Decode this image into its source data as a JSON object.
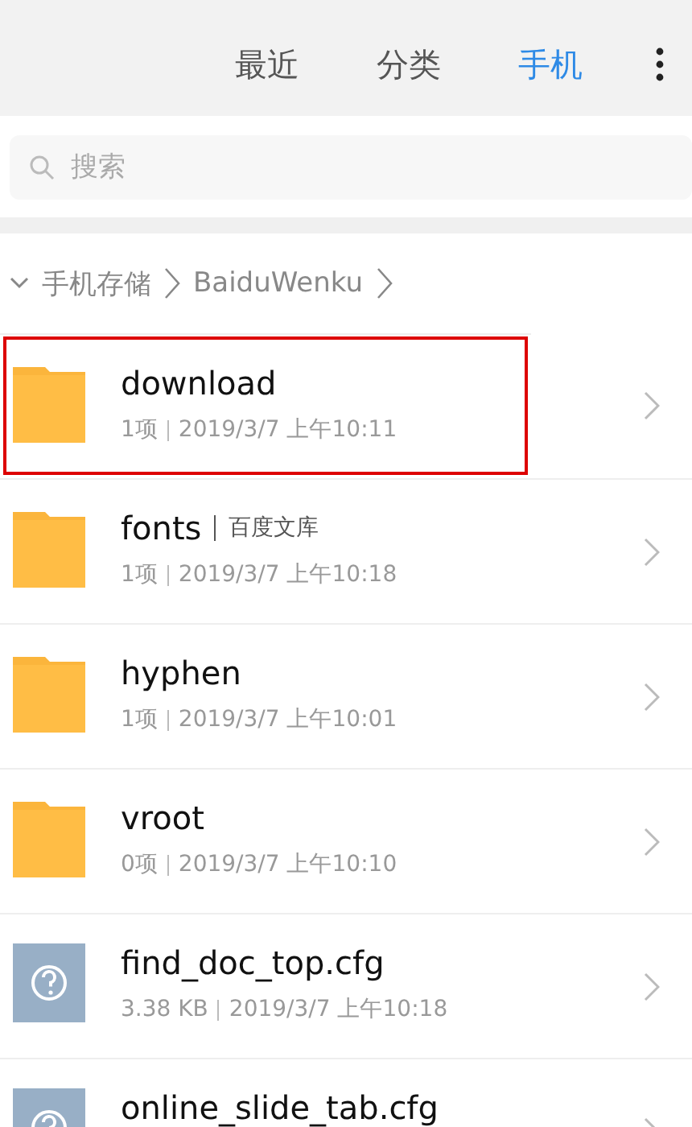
{
  "tabs": [
    {
      "label": "最近",
      "selected": false
    },
    {
      "label": "分类",
      "selected": false
    },
    {
      "label": "手机",
      "selected": true
    }
  ],
  "search": {
    "placeholder": "搜索"
  },
  "breadcrumb": [
    "手机存储",
    "BaiduWenku"
  ],
  "items": [
    {
      "kind": "folder",
      "name": "download",
      "size": "1项",
      "date": "2019/3/7 上午10:11",
      "highlighted": true
    },
    {
      "kind": "folder",
      "name": "fonts",
      "tag": "百度文库",
      "size": "1项",
      "date": "2019/3/7 上午10:18",
      "highlighted": false
    },
    {
      "kind": "folder",
      "name": "hyphen",
      "size": "1项",
      "date": "2019/3/7 上午10:01",
      "highlighted": false
    },
    {
      "kind": "folder",
      "name": "vroot",
      "size": "0项",
      "date": "2019/3/7 上午10:10",
      "highlighted": false
    },
    {
      "kind": "file",
      "name": "find_doc_top.cfg",
      "size": "3.38 KB",
      "date": "2019/3/7 上午10:18",
      "highlighted": false
    },
    {
      "kind": "file",
      "name": "online_slide_tab.cfg",
      "highlighted": false
    }
  ]
}
